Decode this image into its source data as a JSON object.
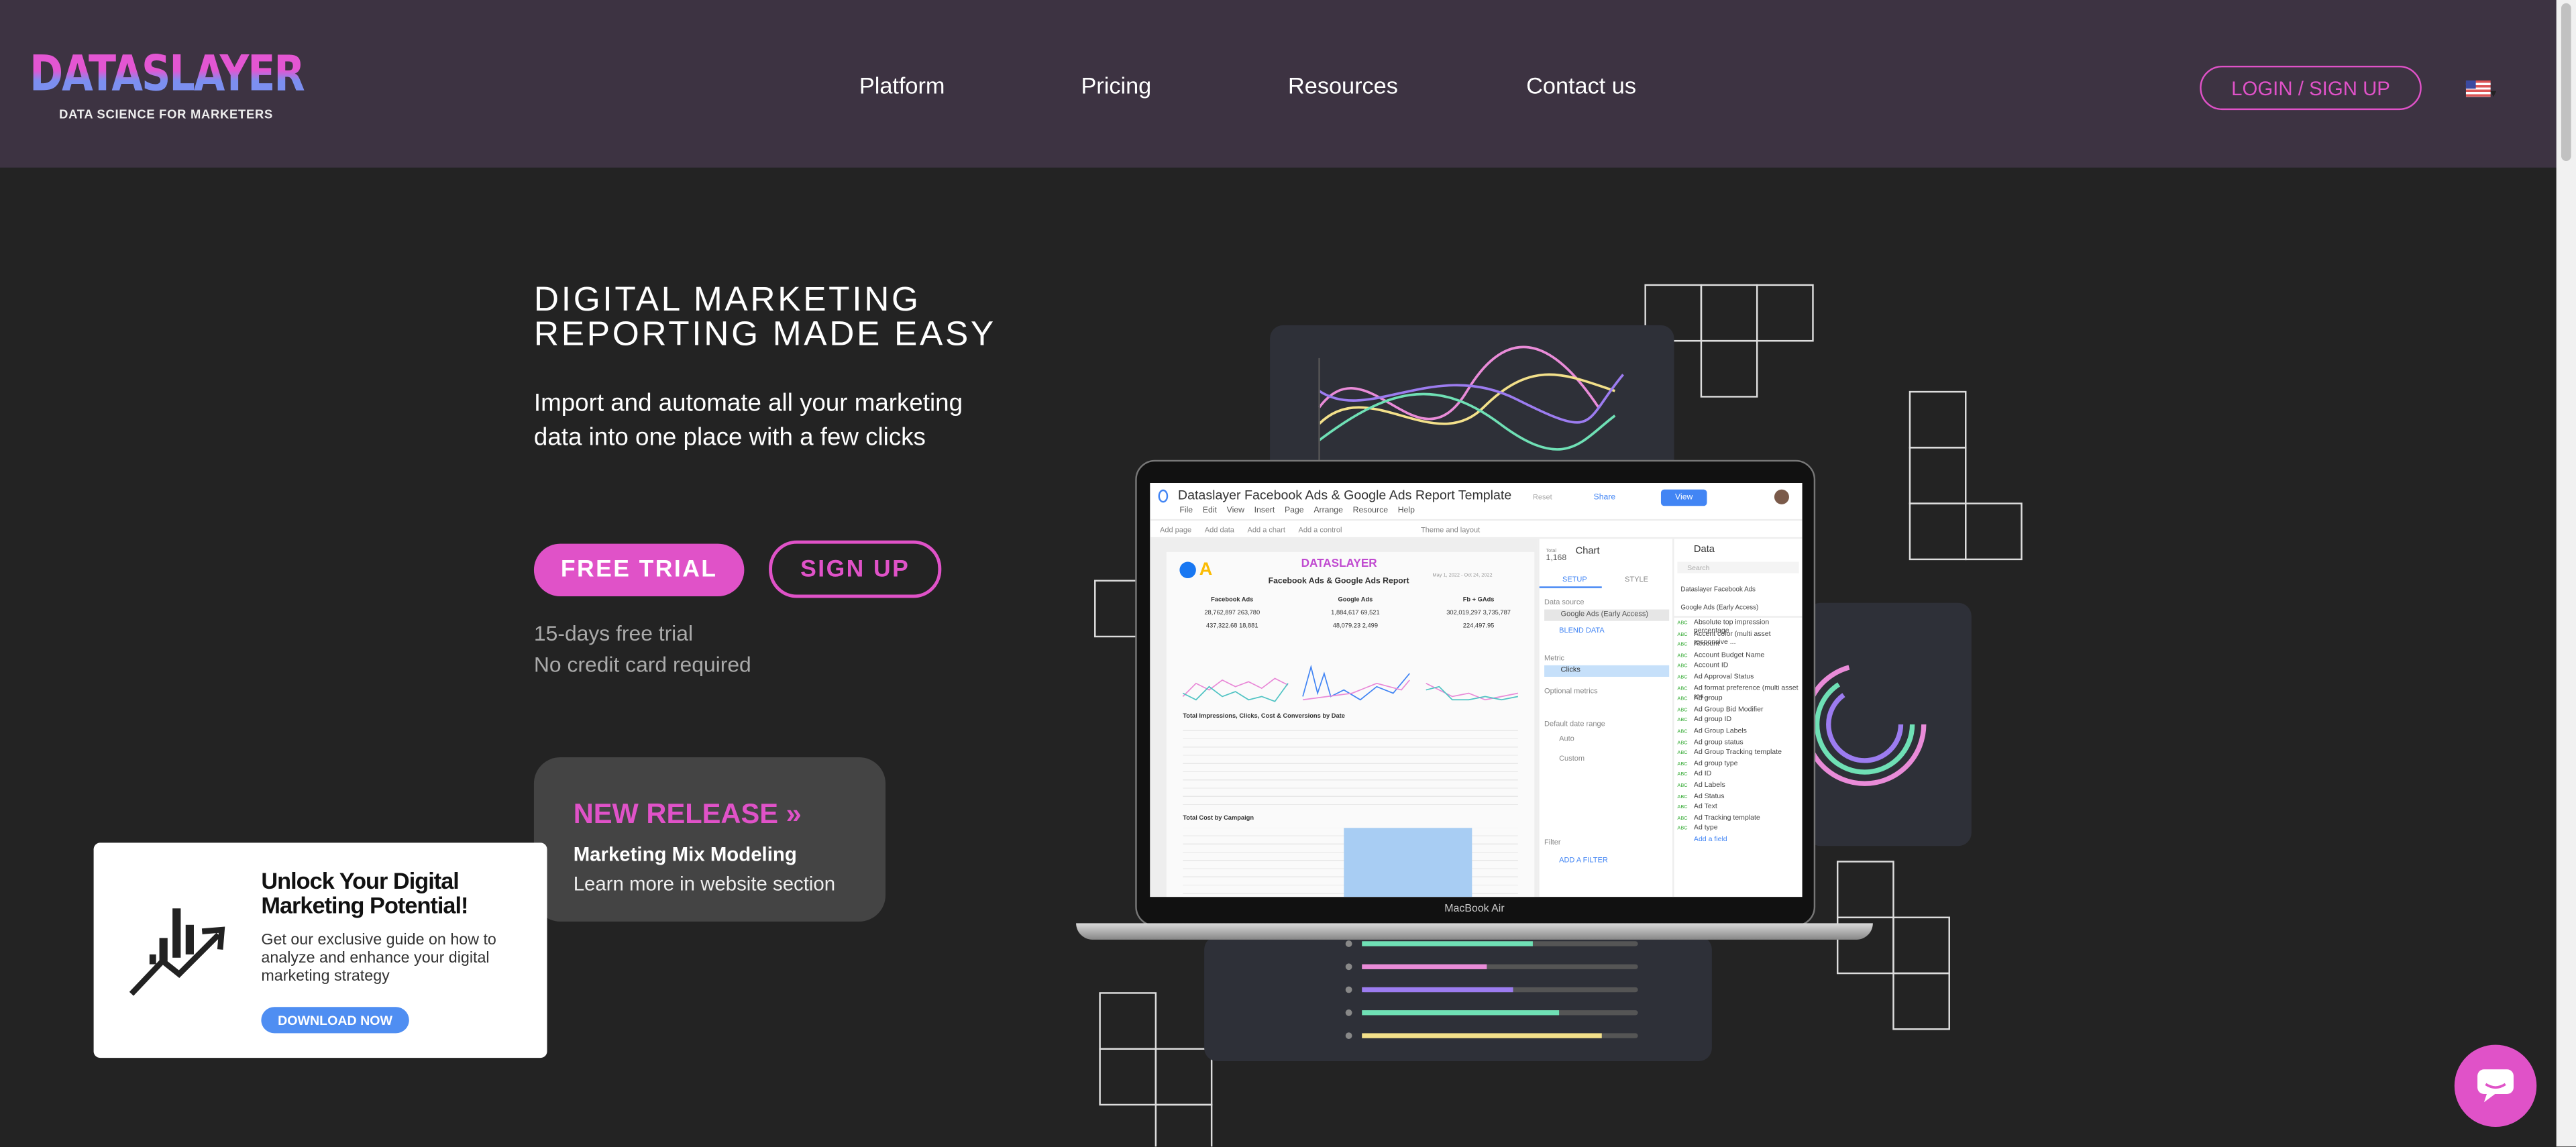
{
  "header": {
    "logo": "DATASLAYER",
    "logo_tagline": "DATA SCIENCE FOR MARKETERS",
    "nav": [
      "Platform",
      "Pricing",
      "Resources",
      "Contact us"
    ],
    "login_label": "LOGIN / SIGN UP",
    "language_icon": "us-flag-icon"
  },
  "hero": {
    "title_line1": "DIGITAL MARKETING",
    "title_line2": "REPORTING MADE EASY",
    "lead": "Import and automate all your marketing data into one place with a few clicks",
    "free_trial_label": "FREE TRIAL",
    "sign_up_label": "SIGN UP",
    "note1": "15-days free trial",
    "note2": "No credit card required"
  },
  "release": {
    "title": "NEW RELEASE »",
    "subtitle": "Marketing Mix Modeling",
    "desc": "Learn more in website section"
  },
  "promo": {
    "title": "Unlock Your Digital Marketing Potential!",
    "desc": "Get our exclusive guide on how to analyze and enhance your digital marketing strategy",
    "button": "DOWNLOAD NOW"
  },
  "colors": {
    "accent": "#e052c8",
    "header_bg": "#3d3342",
    "page_bg": "#232323",
    "promo_button": "#4f8ef2"
  },
  "laptop": {
    "label": "MacBook Air",
    "title": "Dataslayer Facebook Ads & Google Ads Report Template",
    "menu": [
      "File",
      "Edit",
      "View",
      "Insert",
      "Page",
      "Arrange",
      "Resource",
      "Help"
    ],
    "toolbar": [
      "Add page",
      "Add data",
      "Add a chart",
      "Add a control",
      "Theme and layout"
    ],
    "reset": "Reset",
    "share": "Share",
    "view": "View",
    "report": {
      "logo": "DATASLAYER",
      "title": "Facebook Ads & Google Ads Report",
      "date": "May 1, 2022 - Oct 24, 2022",
      "columns": [
        {
          "name": "Facebook Ads",
          "values": [
            "28,762,897",
            "263,780",
            "437,322.68",
            "18,881"
          ]
        },
        {
          "name": "Google Ads",
          "values": [
            "1,884,617",
            "69,521",
            "48,079.23",
            "2,499"
          ]
        },
        {
          "name": "Fb + GAds",
          "values": [
            "302,019,297",
            "3,735,787",
            "224,497.95"
          ]
        }
      ],
      "table1": "Total Impressions, Clicks, Cost & Conversions by Date",
      "table2": "Total Cost by Campaign"
    },
    "panel": {
      "total_label": "Total",
      "total": "1,168",
      "chart": "Chart",
      "tabs": [
        "SETUP",
        "STYLE"
      ],
      "data_source_label": "Data source",
      "data_source": "Google Ads (Early Access)",
      "blend": "BLEND DATA",
      "metric_label": "Metric",
      "metric": "Clicks",
      "optional": "Optional metrics",
      "date_range": "Default date range",
      "auto": "Auto",
      "custom": "Custom",
      "filter": "Filter",
      "add_filter": "ADD A FILTER"
    },
    "data": {
      "title": "Data",
      "search": "Search",
      "sources": [
        "Dataslayer Facebook Ads",
        "Google Ads (Early Access)"
      ],
      "fields": [
        "Absolute top impression percentage",
        "Accent color (multi asset responsive ...",
        "Account",
        "Account Budget Name",
        "Account ID",
        "Ad Approval Status",
        "Ad format preference (multi asset res...",
        "Ad group",
        "Ad Group Bid Modifier",
        "Ad group ID",
        "Ad Group Labels",
        "Ad group status",
        "Ad Group Tracking template",
        "Ad group type",
        "Ad ID",
        "Ad Labels",
        "Ad Status",
        "Ad Text",
        "Ad Tracking template",
        "Ad type"
      ],
      "add_field": "Add a field"
    }
  }
}
